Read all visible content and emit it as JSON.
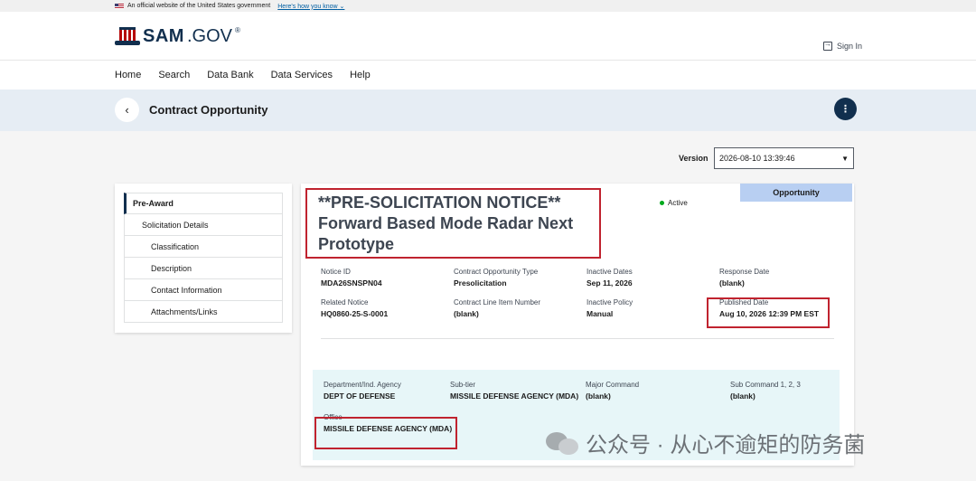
{
  "gov_banner": {
    "text": "An official website of the United States government",
    "link": "Here's how you know",
    "chevron": "⌄"
  },
  "header": {
    "logo_sam": "SAM",
    "logo_gov": ".GOV",
    "logo_reg": "®",
    "signin": "Sign In"
  },
  "nav": {
    "items": [
      "Home",
      "Search",
      "Data Bank",
      "Data Services",
      "Help"
    ]
  },
  "title_bar": {
    "title": "Contract Opportunity",
    "back_icon": "‹",
    "menu_icon": "⋮"
  },
  "version": {
    "label": "Version",
    "value": "2026-08-10 13:39:46",
    "caret": "▼"
  },
  "sidenav": {
    "items": [
      {
        "label": "Pre-Award",
        "level": 0
      },
      {
        "label": "Solicitation Details",
        "level": 1
      },
      {
        "label": "Classification",
        "level": 2
      },
      {
        "label": "Description",
        "level": 2
      },
      {
        "label": "Contact Information",
        "level": 2
      },
      {
        "label": "Attachments/Links",
        "level": 2
      }
    ]
  },
  "notice": {
    "tab": "Opportunity",
    "status": "Active",
    "title": "**PRE-SOLICITATION NOTICE** Forward Based Mode Radar Next Prototype"
  },
  "fields": {
    "notice_id": {
      "label": "Notice ID",
      "value": "MDA26SNSPN04"
    },
    "type": {
      "label": "Contract Opportunity Type",
      "value": "Presolicitation"
    },
    "inactive_dates": {
      "label": "Inactive Dates",
      "value": "Sep 11, 2026"
    },
    "response_date": {
      "label": "Response Date",
      "value": "(blank)"
    },
    "related_notice": {
      "label": "Related Notice",
      "value": "HQ0860-25-S-0001"
    },
    "cli_number": {
      "label": "Contract Line Item Number",
      "value": "(blank)"
    },
    "inactive_policy": {
      "label": "Inactive Policy",
      "value": "Manual"
    },
    "published_date": {
      "label": "Published Date",
      "value": "Aug 10, 2026 12:39 PM EST"
    }
  },
  "agency": {
    "department": {
      "label": "Department/Ind. Agency",
      "value": "DEPT OF DEFENSE"
    },
    "sub_tier": {
      "label": "Sub-tier",
      "value": "MISSILE DEFENSE AGENCY (MDA)"
    },
    "major_command": {
      "label": "Major Command",
      "value": "(blank)"
    },
    "sub_command": {
      "label": "Sub Command 1, 2, 3",
      "value": "(blank)"
    },
    "office": {
      "label": "Office",
      "value": "MISSILE DEFENSE AGENCY (MDA)"
    }
  },
  "watermark": {
    "text": "公众号 · 从心不逾矩的防务菌"
  }
}
